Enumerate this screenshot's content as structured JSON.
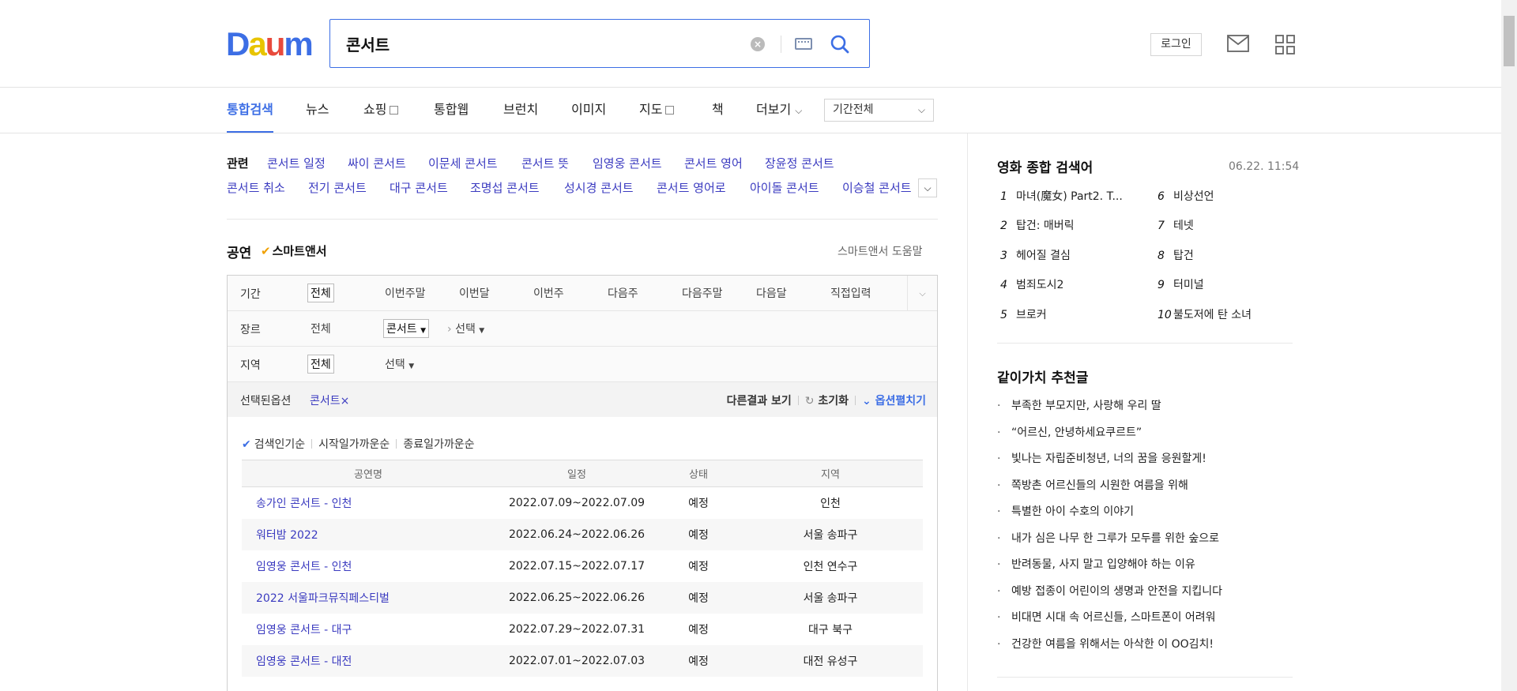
{
  "header": {
    "logo": "Daum",
    "search_value": "콘서트",
    "login": "로그인"
  },
  "tabs": [
    {
      "label": "통합검색",
      "active": true
    },
    {
      "label": "뉴스"
    },
    {
      "label": "쇼핑",
      "box": true
    },
    {
      "label": "통합웹"
    },
    {
      "label": "브런치"
    },
    {
      "label": "이미지"
    },
    {
      "label": "지도",
      "box": true
    },
    {
      "label": "책"
    },
    {
      "label": "더보기",
      "chevron": true
    }
  ],
  "period_select": "기간전체",
  "related": {
    "title": "관련",
    "row1": [
      "콘서트 일정",
      "싸이 콘서트",
      "이문세 콘서트",
      "콘서트 뜻",
      "임영웅 콘서트",
      "콘서트 영어",
      "장윤정 콘서트"
    ],
    "row2": [
      "콘서트 취소",
      "전기 콘서트",
      "대구 콘서트",
      "조명섭 콘서트",
      "성시경 콘서트",
      "콘서트 영어로",
      "아이돌 콘서트",
      "이승철 콘서트"
    ]
  },
  "smart_answer": {
    "title": "공연",
    "badge": "스마트앤서",
    "help": "스마트앤서 도움말"
  },
  "filters": {
    "period": {
      "label": "기간",
      "options": [
        "전체",
        "이번주말",
        "이번달",
        "이번주",
        "다음주",
        "다음주말",
        "다음달",
        "직접입력"
      ]
    },
    "genre": {
      "label": "장르",
      "all": "전체",
      "selected": "콘서트",
      "sub": "선택"
    },
    "region": {
      "label": "지역",
      "all": "전체",
      "sub": "선택"
    },
    "selected": {
      "label": "선택된옵션",
      "chip": "콘서트",
      "other": "다른결과 보기",
      "reset": "초기화",
      "expand": "옵션펼치기"
    }
  },
  "sort": [
    "검색인기순",
    "시작일가까운순",
    "종료일가까운순"
  ],
  "table": {
    "headers": [
      "공연명",
      "일정",
      "상태",
      "지역"
    ],
    "rows": [
      [
        "송가인 콘서트 - 인천",
        "2022.07.09~2022.07.09",
        "예정",
        "인천"
      ],
      [
        "워터밤 2022",
        "2022.06.24~2022.06.26",
        "예정",
        "서울 송파구"
      ],
      [
        "임영웅 콘서트 - 인천",
        "2022.07.15~2022.07.17",
        "예정",
        "인천 연수구"
      ],
      [
        "2022 서울파크뮤직페스티벌",
        "2022.06.25~2022.06.26",
        "예정",
        "서울 송파구"
      ],
      [
        "임영웅 콘서트 - 대구",
        "2022.07.29~2022.07.31",
        "예정",
        "대구 북구"
      ],
      [
        "임영웅 콘서트 - 대전",
        "2022.07.01~2022.07.03",
        "예정",
        "대전 유성구"
      ]
    ]
  },
  "ranking": {
    "title": "영화 종합 검색어",
    "time": "06.22. 11:54",
    "items": [
      {
        "num": "1",
        "text": "마녀(魔女) Part2. T..."
      },
      {
        "num": "2",
        "text": "탑건: 매버릭"
      },
      {
        "num": "3",
        "text": "헤어질 결심"
      },
      {
        "num": "4",
        "text": "범죄도시2"
      },
      {
        "num": "5",
        "text": "브로커"
      },
      {
        "num": "6",
        "text": "비상선언"
      },
      {
        "num": "7",
        "text": "테넷"
      },
      {
        "num": "8",
        "text": "탑건"
      },
      {
        "num": "9",
        "text": "터미널"
      },
      {
        "num": "10",
        "text": "불도저에 탄 소녀"
      }
    ]
  },
  "recommend": {
    "title": "같이가치 추천글",
    "items": [
      "부족한 부모지만, 사랑해 우리 딸",
      "“어르신, 안녕하세요쿠르트”",
      "빛나는 자립준비청년, 너의 꿈을 응원할게!",
      "쪽방촌 어르신들의 시원한 여름을 위해",
      "특별한 아이 수호의 이야기",
      "내가 심은 나무 한 그루가 모두를 위한 숲으로",
      "반려동물, 사지 말고 입양해야 하는 이유",
      "예방 접종이 어린이의 생명과 안전을 지킵니다",
      "비대면 시대 속 어르신들, 스마트폰이 어려워",
      "건강한 여름을 위해서는 아삭한 이 OO김치!"
    ]
  }
}
